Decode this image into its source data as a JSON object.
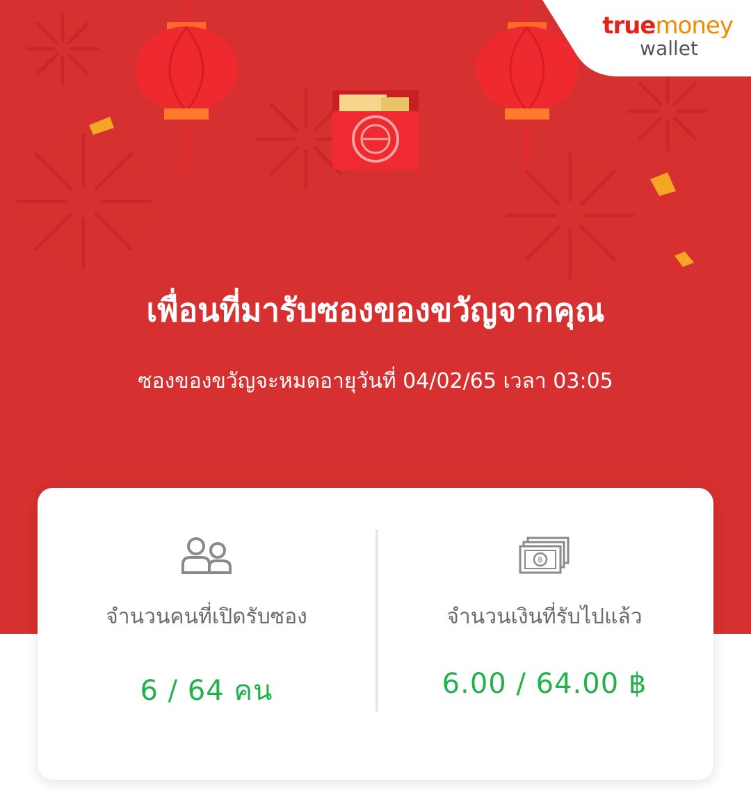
{
  "brand": {
    "name_true": "true",
    "name_money": "money",
    "sub": "wallet"
  },
  "headline": "เพื่อนที่มารับซองของขวัญจากคุณ",
  "expiry": "ซองของขวัญจะหมดอายุวันที่ 04/02/65 เวลา 03:05",
  "stats": {
    "people": {
      "label": "จำนวนคนที่เปิดรับซอง",
      "value": "6 / 64 คน"
    },
    "money": {
      "label": "จำนวนเงินที่รับไปแล้ว",
      "value": "6.00 / 64.00 ฿"
    }
  },
  "colors": {
    "background": "#d63031",
    "accent_value": "#22b24c",
    "brand_red": "#e1251b",
    "brand_orange": "#f08a00"
  },
  "icons": [
    "people-icon",
    "banknote-icon",
    "red-envelope-icon",
    "lantern-icon"
  ]
}
